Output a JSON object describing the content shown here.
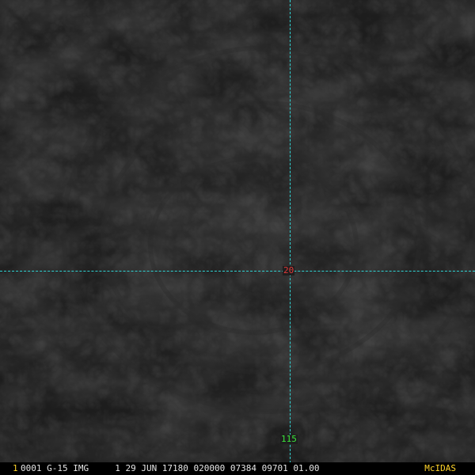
{
  "frame_number": "1",
  "image_header": "0001 G-15 IMG     1 29 JUN 17180 020000 07384 09701 01.00",
  "brand": "McIDAS",
  "grid": {
    "latitude_label": "20",
    "longitude_label": "115"
  },
  "colors": {
    "gridline": "#2fd3d3",
    "latitude_label": "#e23a3a",
    "longitude_label": "#3be43b",
    "frame_number": "#ffd42a",
    "brand": "#ffd42a",
    "header_text": "#e6e6e6"
  }
}
